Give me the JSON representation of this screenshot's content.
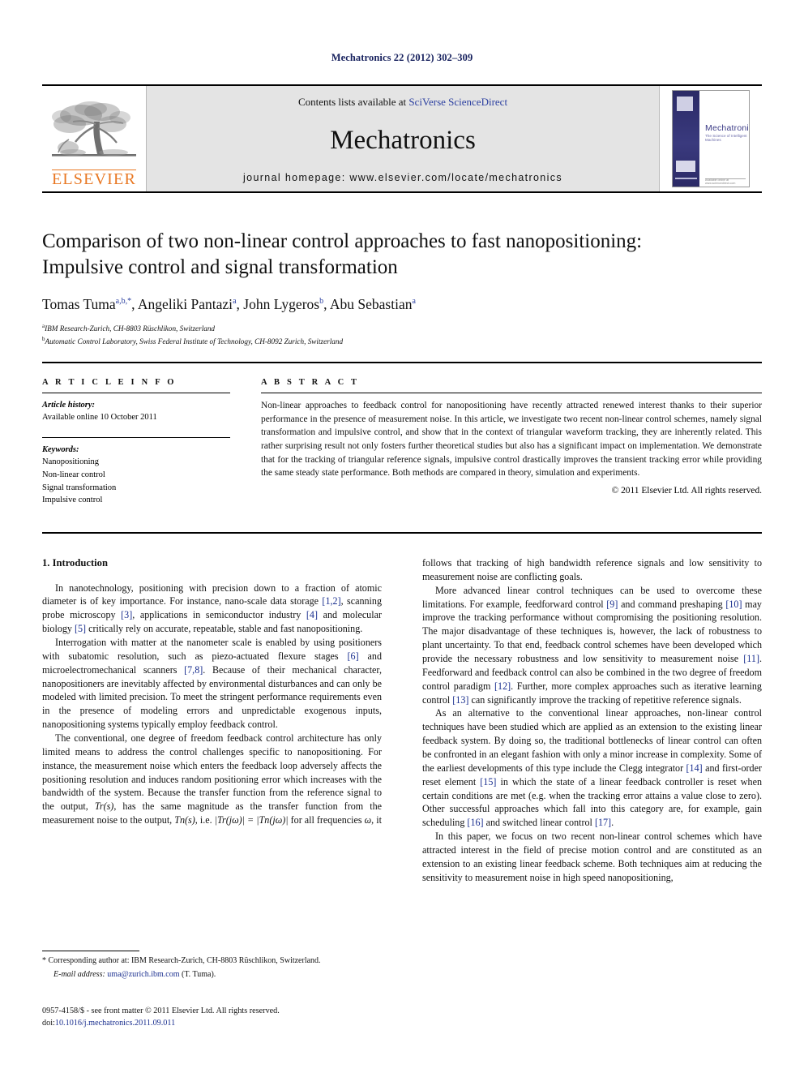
{
  "running_head": "Mechatronics 22 (2012) 302–309",
  "masthead": {
    "publisher_name": "ELSEVIER",
    "contents_prefix": "Contents lists available at ",
    "contents_link": "SciVerse ScienceDirect",
    "journal_name": "Mechatronics",
    "homepage": "journal homepage: www.elsevier.com/locate/mechatronics",
    "cover": {
      "title": "Mechatronics",
      "subtitle": "The Science of Intelligent Machines",
      "footer_text": "Available online at www.sciencedirect.com"
    }
  },
  "article": {
    "title_line1": "Comparison of two non-linear control approaches to fast nanopositioning:",
    "title_line2": "Impulsive control and signal transformation",
    "authors": [
      {
        "name": "Tomas Tuma",
        "marks": "a,b,*"
      },
      {
        "name": "Angeliki Pantazi",
        "marks": "a"
      },
      {
        "name": "John Lygeros",
        "marks": "b"
      },
      {
        "name": "Abu Sebastian",
        "marks": "a"
      }
    ],
    "affiliations": [
      {
        "mark": "a",
        "text": "IBM Research-Zurich, CH-8803 Rüschlikon, Switzerland"
      },
      {
        "mark": "b",
        "text": "Automatic Control Laboratory, Swiss Federal Institute of Technology, CH-8092 Zurich, Switzerland"
      }
    ]
  },
  "info": {
    "heading": "A R T I C L E    I N F O",
    "history_label": "Article history:",
    "history_value": "Available online 10 October 2011",
    "keywords_label": "Keywords:",
    "keywords": [
      "Nanopositioning",
      "Non-linear control",
      "Signal transformation",
      "Impulsive control"
    ]
  },
  "abstract": {
    "heading": "A B S T R A C T",
    "text": "Non-linear approaches to feedback control for nanopositioning have recently attracted renewed interest thanks to their superior performance in the presence of measurement noise. In this article, we investigate two recent non-linear control schemes, namely signal transformation and impulsive control, and show that in the context of triangular waveform tracking, they are inherently related. This rather surprising result not only fosters further theoretical studies but also has a significant impact on implementation. We demonstrate that for the tracking of triangular reference signals, impulsive control drastically improves the transient tracking error while providing the same steady state performance. Both methods are compared in theory, simulation and experiments.",
    "copyright": "© 2011 Elsevier Ltd. All rights reserved."
  },
  "body": {
    "section_title": "1. Introduction",
    "left_paragraphs": [
      {
        "segments": [
          {
            "t": "In nanotechnology, positioning with precision down to a fraction of atomic diameter is of key importance. For instance, nano-scale data storage "
          },
          {
            "t": "[1,2]",
            "ref": true
          },
          {
            "t": ", scanning probe microscopy "
          },
          {
            "t": "[3]",
            "ref": true
          },
          {
            "t": ", applications in semiconductor industry "
          },
          {
            "t": "[4]",
            "ref": true
          },
          {
            "t": " and molecular biology "
          },
          {
            "t": "[5]",
            "ref": true
          },
          {
            "t": " critically rely on accurate, repeatable, stable and fast nanopositioning."
          }
        ]
      },
      {
        "segments": [
          {
            "t": "Interrogation with matter at the nanometer scale is enabled by using positioners with subatomic resolution, such as piezo-actuated flexure stages "
          },
          {
            "t": "[6]",
            "ref": true
          },
          {
            "t": " and microelectromechanical scanners "
          },
          {
            "t": "[7,8]",
            "ref": true
          },
          {
            "t": ". Because of their mechanical character, nanopositioners are inevitably affected by environmental disturbances and can only be modeled with limited precision. To meet the stringent performance requirements even in the presence of modeling errors and unpredictable exogenous inputs, nanopositioning systems typically employ feedback control."
          }
        ]
      },
      {
        "segments": [
          {
            "t": "The conventional, one degree of freedom feedback control architecture has only limited means to address the control challenges specific to nanopositioning. For instance, the measurement noise which enters the feedback loop adversely affects the positioning resolution and induces random positioning error which increases with the bandwidth of the system. Because the transfer function from the reference signal to the output, "
          },
          {
            "t": "Tr(s)",
            "math": true
          },
          {
            "t": ", has the same magnitude as the transfer function from the measurement noise to the output, "
          },
          {
            "t": "Tn(s)",
            "math": true
          },
          {
            "t": ", i.e. "
          },
          {
            "t": "|Tr(jω)| = |Tn(jω)|",
            "math": true
          },
          {
            "t": " for all frequencies "
          },
          {
            "t": "ω",
            "math": true
          },
          {
            "t": ", it"
          }
        ]
      }
    ],
    "right_paragraphs": [
      {
        "noindent": true,
        "segments": [
          {
            "t": "follows that tracking of high bandwidth reference signals and low sensitivity to measurement noise are conflicting goals."
          }
        ]
      },
      {
        "segments": [
          {
            "t": "More advanced linear control techniques can be used to overcome these limitations. For example, feedforward control "
          },
          {
            "t": "[9]",
            "ref": true
          },
          {
            "t": " and command preshaping "
          },
          {
            "t": "[10]",
            "ref": true
          },
          {
            "t": " may improve the tracking performance without compromising the positioning resolution. The major disadvantage of these techniques is, however, the lack of robustness to plant uncertainty. To that end, feedback control schemes have been developed which provide the necessary robustness and low sensitivity to measurement noise "
          },
          {
            "t": "[11]",
            "ref": true
          },
          {
            "t": ". Feedforward and feedback control can also be combined in the two degree of freedom control paradigm "
          },
          {
            "t": "[12]",
            "ref": true
          },
          {
            "t": ". Further, more complex approaches such as iterative learning control "
          },
          {
            "t": "[13]",
            "ref": true
          },
          {
            "t": " can significantly improve the tracking of repetitive reference signals."
          }
        ]
      },
      {
        "segments": [
          {
            "t": "As an alternative to the conventional linear approaches, non-linear control techniques have been studied which are applied as an extension to the existing linear feedback system. By doing so, the traditional bottlenecks of linear control can often be confronted in an elegant fashion with only a minor increase in complexity. Some of the earliest developments of this type include the Clegg integrator "
          },
          {
            "t": "[14]",
            "ref": true
          },
          {
            "t": " and first-order reset element "
          },
          {
            "t": "[15]",
            "ref": true
          },
          {
            "t": " in which the state of a linear feedback controller is reset when certain conditions are met (e.g. when the tracking error attains a value close to zero). Other successful approaches which fall into this category are, for example, gain scheduling "
          },
          {
            "t": "[16]",
            "ref": true
          },
          {
            "t": " and switched linear control "
          },
          {
            "t": "[17]",
            "ref": true
          },
          {
            "t": "."
          }
        ]
      },
      {
        "segments": [
          {
            "t": "In this paper, we focus on two recent non-linear control schemes which have attracted interest in the field of precise motion control and are constituted as an extension to an existing linear feedback scheme. Both techniques aim at reducing the sensitivity to measurement noise in high speed nanopositioning,"
          }
        ]
      }
    ]
  },
  "footnote": {
    "corresponding": "* Corresponding author at: IBM Research-Zurich, CH-8803 Rüschlikon, Switzerland.",
    "email_label": "E-mail address:",
    "email": "uma@zurich.ibm.com",
    "email_suffix": "(T. Tuma)."
  },
  "footer": {
    "issn_line": "0957-4158/$ - see front matter © 2011 Elsevier Ltd. All rights reserved.",
    "doi_label": "doi:",
    "doi": "10.1016/j.mechatronics.2011.09.011"
  }
}
